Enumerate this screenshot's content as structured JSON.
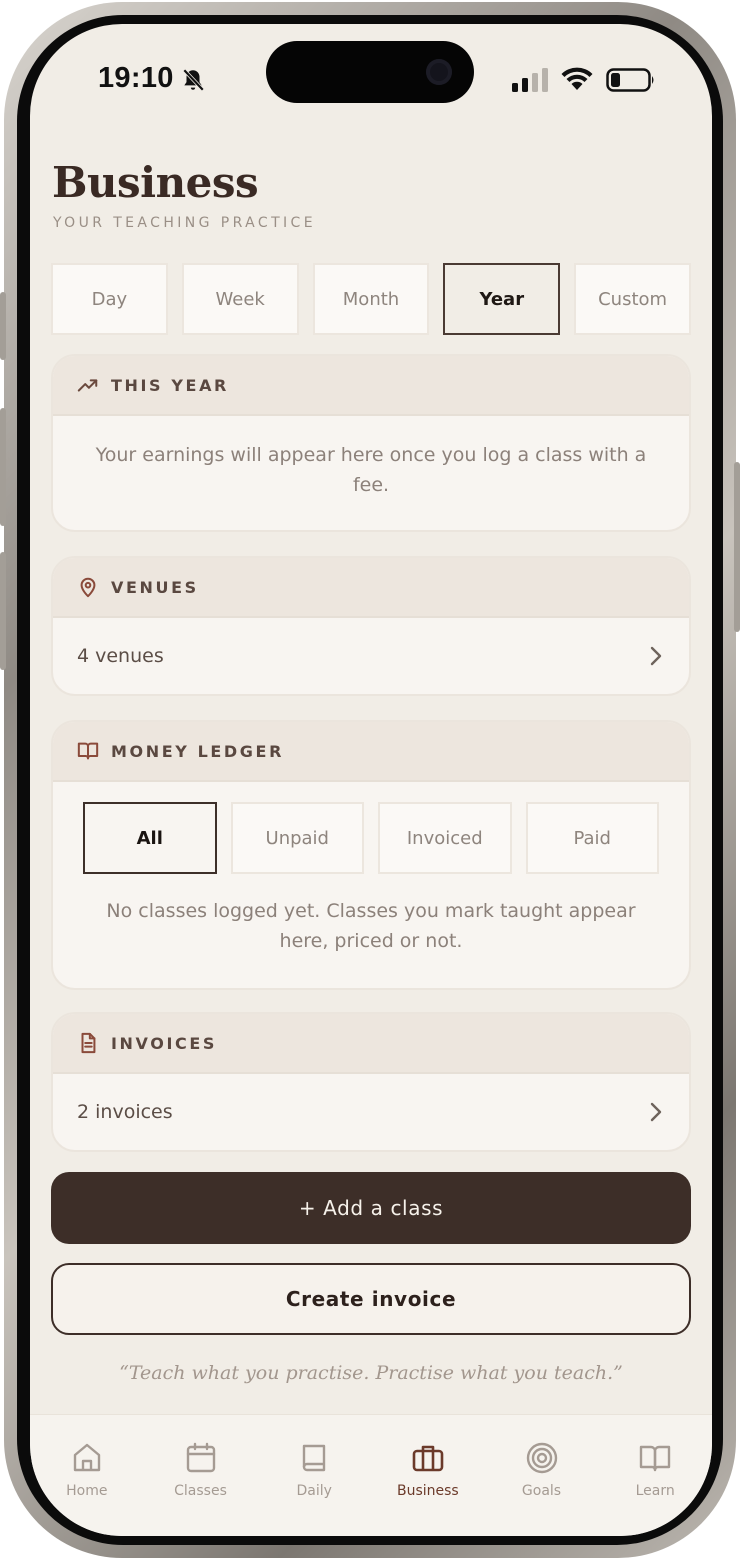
{
  "status_bar": {
    "time": "19:10"
  },
  "header": {
    "title": "Business",
    "subtitle": "YOUR TEACHING PRACTICE"
  },
  "period_tabs": [
    {
      "label": "Day",
      "active": false
    },
    {
      "label": "Week",
      "active": false
    },
    {
      "label": "Month",
      "active": false
    },
    {
      "label": "Year",
      "active": true
    },
    {
      "label": "Custom",
      "active": false
    }
  ],
  "this_year": {
    "title": "THIS YEAR",
    "icon": "trending-up-icon",
    "message": "Your earnings will appear here once you log a class with a fee."
  },
  "venues": {
    "title": "VENUES",
    "icon": "map-pin-icon",
    "summary": "4 venues"
  },
  "money_ledger": {
    "title": "MONEY LEDGER",
    "icon": "open-book-icon",
    "filters": [
      {
        "label": "All",
        "active": true
      },
      {
        "label": "Unpaid",
        "active": false
      },
      {
        "label": "Invoiced",
        "active": false
      },
      {
        "label": "Paid",
        "active": false
      }
    ],
    "empty_message": "No classes logged yet. Classes you mark taught appear here, priced or not."
  },
  "invoices": {
    "title": "INVOICES",
    "icon": "document-icon",
    "summary": "2 invoices"
  },
  "actions": {
    "add_class": "+ Add a class",
    "create_invoice": "Create invoice"
  },
  "quote": "“Teach what you practise. Practise what you teach.”",
  "bottom_nav": [
    {
      "label": "Home",
      "icon": "home-icon",
      "active": false
    },
    {
      "label": "Classes",
      "icon": "calendar-icon",
      "active": false
    },
    {
      "label": "Daily",
      "icon": "book-icon",
      "active": false
    },
    {
      "label": "Business",
      "icon": "briefcase-icon",
      "active": true
    },
    {
      "label": "Goals",
      "icon": "target-icon",
      "active": false
    },
    {
      "label": "Learn",
      "icon": "open-book-icon",
      "active": false
    }
  ],
  "colors": {
    "accent": "#3d2e28",
    "active_nav": "#6b3a2a",
    "background": "#f1ede6"
  }
}
